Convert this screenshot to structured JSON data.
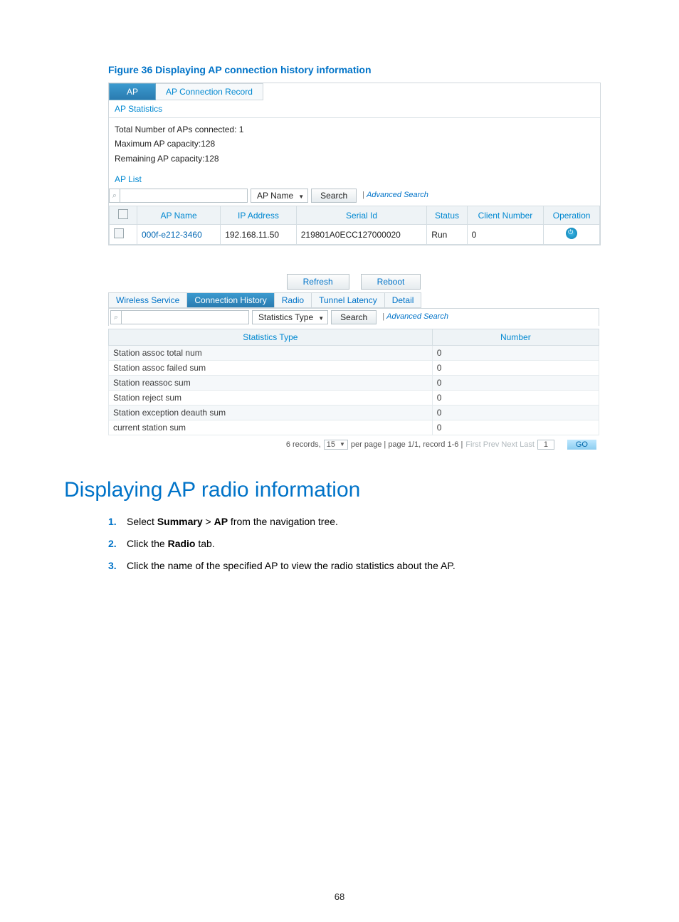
{
  "figure_caption": "Figure 36 Displaying AP connection history information",
  "ss1": {
    "tab_ap": "AP",
    "tab_conn_record": "AP Connection Record",
    "ap_statistics_link": "AP Statistics",
    "stats": {
      "total": "Total Number of APs connected: 1",
      "max": "Maximum AP capacity:128",
      "remain": "Remaining AP capacity:128"
    },
    "ap_list_title": "AP List",
    "search_field_selected": "AP Name",
    "search_button": "Search",
    "advanced_search": "Advanced Search",
    "columns": {
      "check": "",
      "ap_name": "AP Name",
      "ip": "IP Address",
      "serial": "Serial Id",
      "status": "Status",
      "client": "Client Number",
      "operation": "Operation"
    },
    "row": {
      "ap_name": "000f-e212-3460",
      "ip": "192.168.11.50",
      "serial": "219801A0ECC127000020",
      "status": "Run",
      "client": "0"
    }
  },
  "ss2": {
    "buttons": {
      "refresh": "Refresh",
      "reboot": "Reboot"
    },
    "tabs": {
      "wireless": "Wireless Service",
      "conn_hist": "Connection History",
      "radio": "Radio",
      "tunnel": "Tunnel Latency",
      "detail": "Detail"
    },
    "search_field_selected": "Statistics Type",
    "search_button": "Search",
    "advanced_search": "Advanced Search",
    "headers": {
      "type": "Statistics Type",
      "number": "Number"
    },
    "rows": [
      {
        "type": "Station assoc total num",
        "number": "0"
      },
      {
        "type": "Station assoc failed sum",
        "number": "0"
      },
      {
        "type": "Station reassoc sum",
        "number": "0"
      },
      {
        "type": "Station reject sum",
        "number": "0"
      },
      {
        "type": "Station exception deauth sum",
        "number": "0"
      },
      {
        "type": "current station sum",
        "number": "0"
      }
    ],
    "pager": {
      "records_prefix": "6 records,",
      "per_page_value": "15",
      "mid": "per page | page 1/1, record 1-6 |",
      "nav": "First Prev Next Last",
      "page_value": "1",
      "go": "GO"
    }
  },
  "chart_data": {
    "type": "table",
    "title": "Connection History statistics",
    "columns": [
      "Statistics Type",
      "Number"
    ],
    "rows": [
      [
        "Station assoc total num",
        0
      ],
      [
        "Station assoc failed sum",
        0
      ],
      [
        "Station reassoc sum",
        0
      ],
      [
        "Station reject sum",
        0
      ],
      [
        "Station exception deauth sum",
        0
      ],
      [
        "current station sum",
        0
      ]
    ]
  },
  "section_heading": "Displaying AP radio information",
  "steps": {
    "s1a": "Select ",
    "s1b": "Summary",
    "s1c": " > ",
    "s1d": "AP",
    "s1e": " from the navigation tree.",
    "s2a": "Click the ",
    "s2b": "Radio",
    "s2c": " tab.",
    "s3": "Click the name of the specified AP to view the radio statistics about the AP."
  },
  "page_number": "68"
}
